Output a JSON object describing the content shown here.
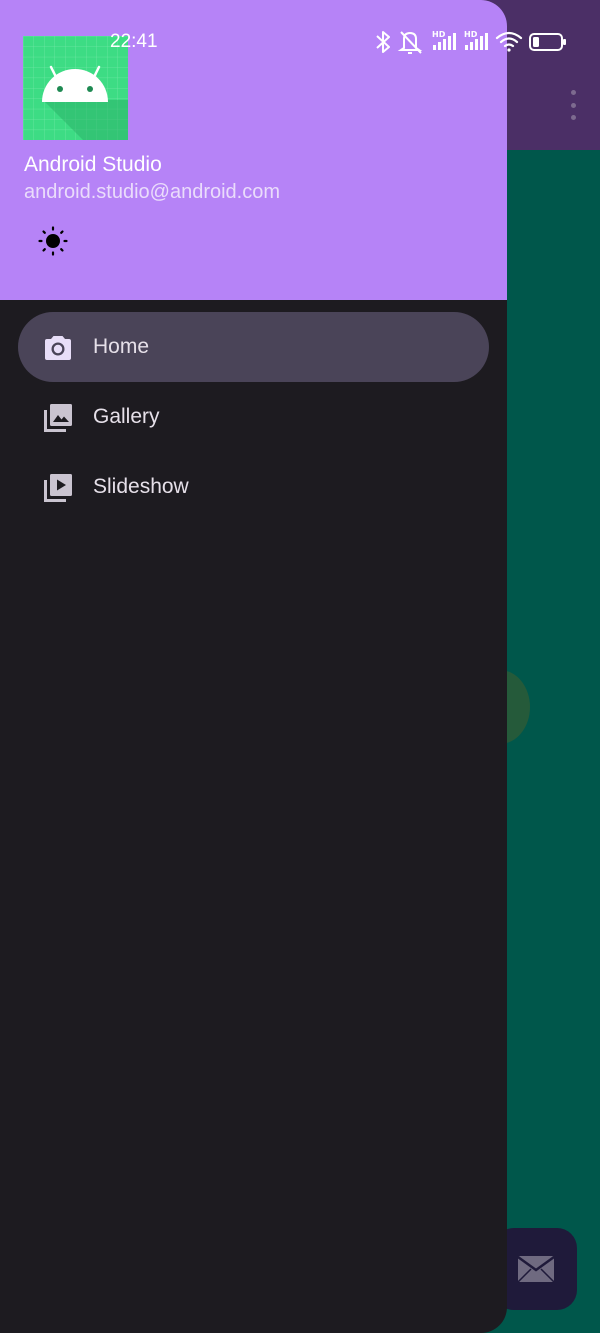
{
  "status_bar": {
    "time": "22:41",
    "icons": [
      "bluetooth-icon",
      "vibrate-off-icon",
      "signal-hd-icon",
      "signal-hd-icon",
      "wifi-icon",
      "battery-icon"
    ]
  },
  "drawer": {
    "header": {
      "name": "Android Studio",
      "email": "android.studio@android.com",
      "avatar_icon": "android-logo",
      "theme_icon": "sun-icon",
      "background": "#b683f7"
    },
    "menu": [
      {
        "label": "Home",
        "icon": "camera-icon",
        "selected": true
      },
      {
        "label": "Gallery",
        "icon": "gallery-icon",
        "selected": false
      },
      {
        "label": "Slideshow",
        "icon": "slideshow-icon",
        "selected": false
      }
    ],
    "background": "#1d1b20",
    "selected_background": "#4a4458"
  },
  "app": {
    "appbar_color": "#4b2f66",
    "content_color": "#00574b",
    "overflow_icon": "more-vert-icon",
    "fab_icon": "email-icon"
  }
}
